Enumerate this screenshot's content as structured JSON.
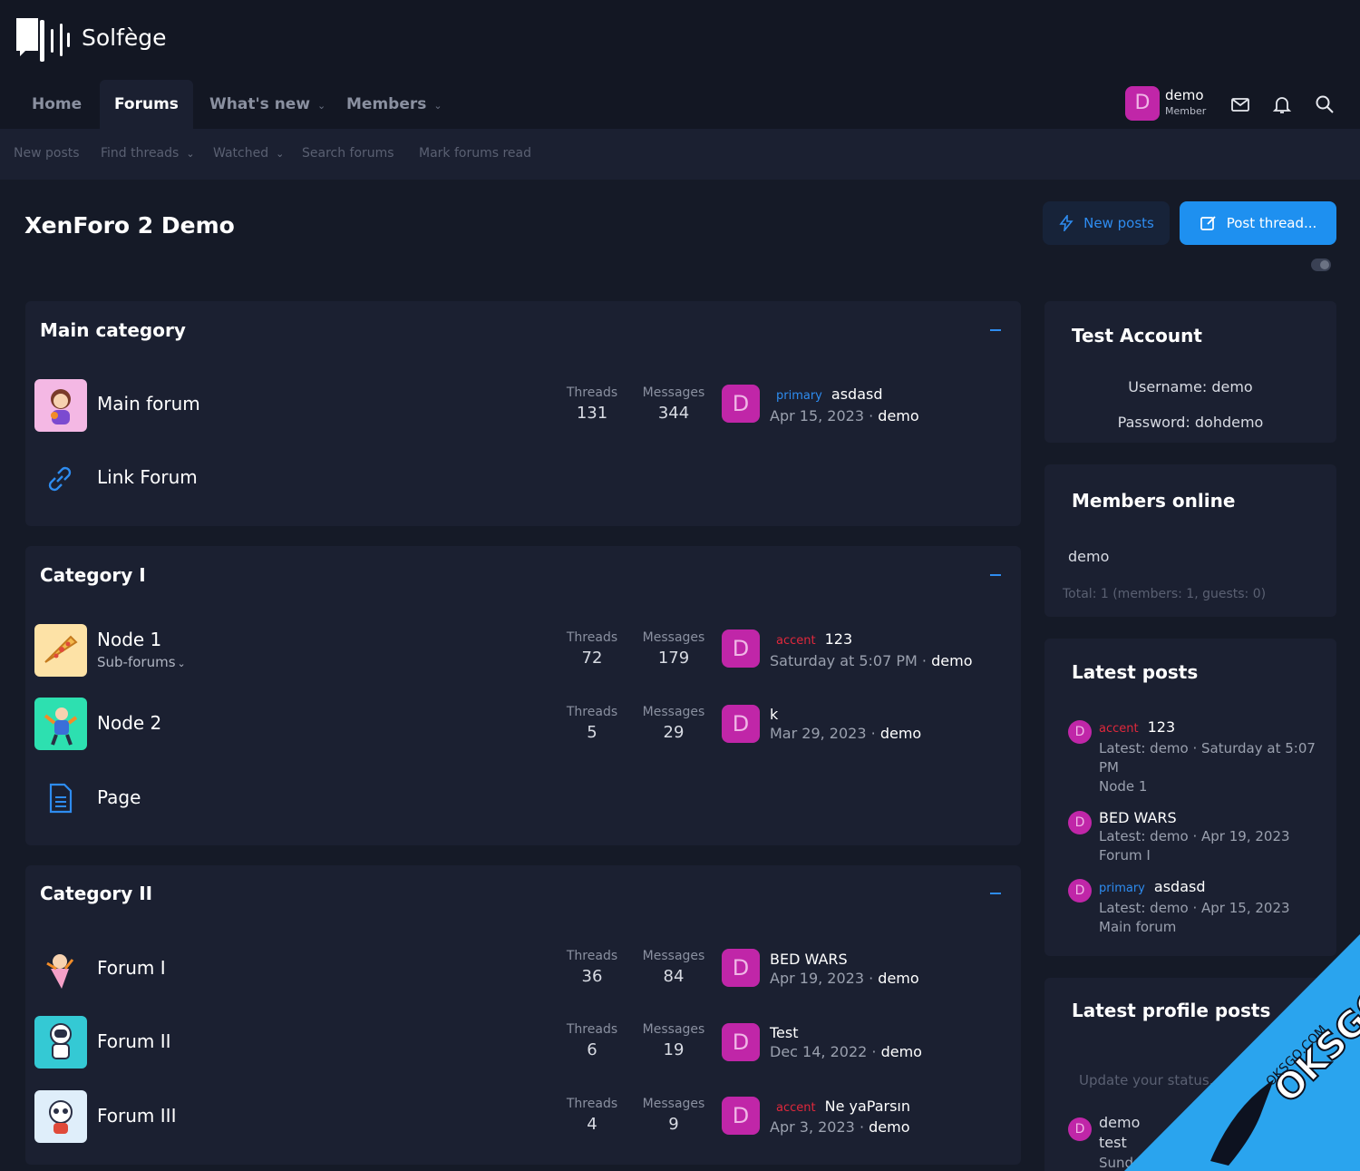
{
  "brand": {
    "name": "Solfège"
  },
  "nav": {
    "tabs": [
      {
        "label": "Home"
      },
      {
        "label": "Forums"
      },
      {
        "label": "What's new"
      },
      {
        "label": "Members"
      }
    ],
    "user": {
      "avatar_letter": "D",
      "name": "demo",
      "role": "Member"
    }
  },
  "subnav": [
    "New posts",
    "Find threads",
    "Watched",
    "Search forums",
    "Mark forums read"
  ],
  "page": {
    "title": "XenForo 2 Demo",
    "new_posts_label": "New posts",
    "post_thread_label": "Post thread..."
  },
  "stat_labels": {
    "threads": "Threads",
    "messages": "Messages"
  },
  "categories": [
    {
      "title": "Main category",
      "nodes": [
        {
          "title": "Main forum",
          "threads": "131",
          "messages": "344",
          "prefix": "primary",
          "last_title": "asdasd",
          "last_date": "Apr 15, 2023",
          "last_user": "demo"
        },
        {
          "title": "Link Forum"
        }
      ]
    },
    {
      "title": "Category I",
      "nodes": [
        {
          "title": "Node 1",
          "subforums": "Sub-forums",
          "threads": "72",
          "messages": "179",
          "prefix": "accent",
          "last_title": "123",
          "last_date": "Saturday at 5:07 PM",
          "last_user": "demo"
        },
        {
          "title": "Node 2",
          "threads": "5",
          "messages": "29",
          "last_title": "k",
          "last_date": "Mar 29, 2023",
          "last_user": "demo"
        },
        {
          "title": "Page"
        }
      ]
    },
    {
      "title": "Category II",
      "nodes": [
        {
          "title": "Forum I",
          "threads": "36",
          "messages": "84",
          "last_title": "BED WARS",
          "last_date": "Apr 19, 2023",
          "last_user": "demo"
        },
        {
          "title": "Forum II",
          "threads": "6",
          "messages": "19",
          "last_title": "Test",
          "last_date": "Dec 14, 2022",
          "last_user": "demo"
        },
        {
          "title": "Forum III",
          "threads": "4",
          "messages": "9",
          "prefix": "accent",
          "last_title": "Ne yaParsın",
          "last_date": "Apr 3, 2023",
          "last_user": "demo"
        }
      ]
    }
  ],
  "sidebar": {
    "test_account": {
      "title": "Test Account",
      "username": "Username: demo",
      "password": "Password: dohdemo"
    },
    "members_online": {
      "title": "Members online",
      "member": "demo",
      "total": "Total: 1 (members: 1, guests: 0)"
    },
    "latest_posts": {
      "title": "Latest posts",
      "items": [
        {
          "prefix": "accent",
          "title": "123",
          "meta1": "Latest: demo · Saturday at 5:07",
          "meta2": "PM",
          "forum": "Node 1"
        },
        {
          "title": "BED WARS",
          "meta1": "Latest: demo · Apr 19, 2023",
          "forum": "Forum I"
        },
        {
          "prefix": "primary",
          "title": "asdasd",
          "meta1": "Latest: demo · Apr 15, 2023",
          "forum": "Main forum"
        }
      ]
    },
    "profile_posts": {
      "title": "Latest profile posts",
      "placeholder": "Update your status...",
      "user": "demo",
      "text": "test",
      "date": "Sunday"
    }
  },
  "separator": "·",
  "colors": {
    "accent_blue": "#1e90f0",
    "avatar_magenta": "#c026a8",
    "prefix_accent": "#e0283c",
    "bg": "#151a27",
    "panel": "#1b2031"
  },
  "watermark": {
    "text1": "OKSGO",
    "text2": "OKSGO.COM"
  }
}
